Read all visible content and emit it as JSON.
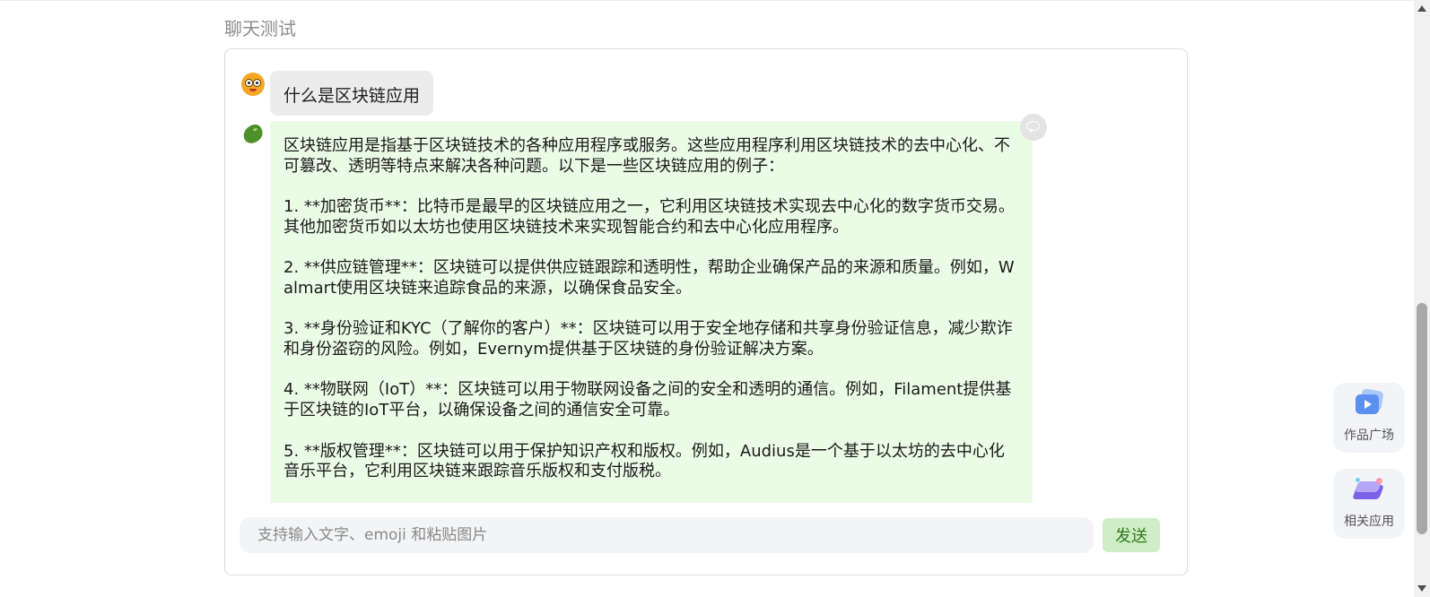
{
  "page": {
    "title": "聊天测试"
  },
  "chat": {
    "messages": [
      {
        "role": "user",
        "avatar_icon": "cartoon-face-avatar",
        "text": "什么是区块链应用"
      },
      {
        "role": "assistant",
        "avatar_icon": "green-bean-avatar",
        "text": "区块链应用是指基于区块链技术的各种应用程序或服务。这些应用程序利用区块链技术的去中心化、不可篡改、透明等特点来解决各种问题。以下是一些区块链应用的例子：\n\n1. **加密货币**：比特币是最早的区块链应用之一，它利用区块链技术实现去中心化的数字货币交易。其他加密货币如以太坊也使用区块链技术来实现智能合约和去中心化应用程序。\n\n2. **供应链管理**：区块链可以提供供应链跟踪和透明性，帮助企业确保产品的来源和质量。例如，Walmart使用区块链来追踪食品的来源，以确保食品安全。\n\n3. **身份验证和KYC（了解你的客户）**：区块链可以用于安全地存储和共享身份验证信息，减少欺诈和身份盗窃的风险。例如，Evernym提供基于区块链的身份验证解决方案。\n\n4. **物联网（IoT）**：区块链可以用于物联网设备之间的安全和透明的通信。例如，Filament提供基于区块链的IoT平台，以确保设备之间的通信安全可靠。\n\n5. **版权管理**：区块链可以用于保护知识产权和版权。例如，Audius是一个基于以太坊的去中心化音乐平台，它利用区块链来跟踪音乐版权和支付版税。"
      }
    ],
    "comment_icon": "comment-icon"
  },
  "composer": {
    "input_value": "",
    "placeholder": "支持输入文字、emoji 和粘贴图片",
    "send_label": "发送"
  },
  "side_panel": {
    "works": {
      "label": "作品广场",
      "icon": "video-gallery-icon"
    },
    "apps": {
      "label": "相关应用",
      "icon": "apps-stack-icon"
    }
  },
  "colors": {
    "assistant_bubble": "#ebfce6",
    "user_bubble": "#ececec",
    "send_button_bg": "#cfeec7",
    "send_button_text": "#2f7a1a",
    "title_gray": "#8c8c8c"
  }
}
